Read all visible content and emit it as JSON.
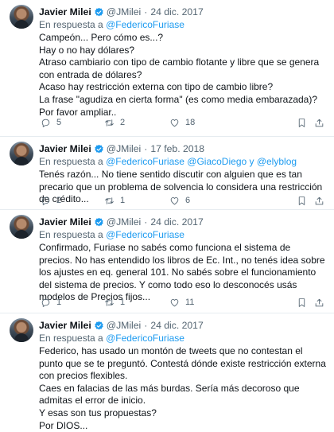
{
  "tweets": [
    {
      "author": "Javier Milei",
      "handle": "@JMilei",
      "date": "24 dic. 2017",
      "reply_prefix": "En respuesta a ",
      "reply_to": "@FedericoFuriase",
      "reply_extra": "",
      "text": "Campeón... Pero cómo es...?\nHay o no hay dólares?\nAtraso cambiario con tipo de cambio flotante y libre que se genera con entrada de dólares?\nAcaso hay restricción externa con tipo de cambio libre?\nLa frase \"agudiza en cierta forma\" (es como media embarazada)?\nPor favor ampliar..",
      "replies": "5",
      "retweets": "2",
      "likes": "18"
    },
    {
      "author": "Javier Milei",
      "handle": "@JMilei",
      "date": "17 feb. 2018",
      "reply_prefix": "En respuesta a ",
      "reply_to": "@FedericoFuriase @GiacoDiego y @elyblog",
      "reply_extra": "",
      "text": "Tenés razón... No tiene sentido discutir con alguien que es tan precario que un problema de solvencia lo considera una restricción de crédito...",
      "replies": "2",
      "retweets": "1",
      "likes": "6"
    },
    {
      "author": "Javier Milei",
      "handle": "@JMilei",
      "date": "24 dic. 2017",
      "reply_prefix": "En respuesta a ",
      "reply_to": "@FedericoFuriase",
      "reply_extra": "",
      "text": "Confirmado, Furiase no sabés como funciona el sistema de precios. No has entendido los libros de Ec. Int., no tenés idea sobre los ajustes en eq. general 101. No sabés sobre el funcionamiento del sistema de precios. Y como todo eso lo desconocés usás modelos de Precios fijos...",
      "replies": "1",
      "retweets": "1",
      "likes": "11"
    },
    {
      "author": "Javier Milei",
      "handle": "@JMilei",
      "date": "24 dic. 2017",
      "reply_prefix": "En respuesta a ",
      "reply_to": "@FedericoFuriase",
      "reply_extra": "",
      "text": "Federico, has usado un montón de tweets que no contestan el punto que se te preguntó. Contestá dónde existe restricción externa con precios flexibles.\nCaes en falacias de las más burdas. Sería más decoroso que admitas el error de inicio.\nY esas son tus propuestas?\nPor DIOS...",
      "replies": "",
      "retweets": "",
      "likes": ""
    }
  ],
  "icons": {
    "verified": "verified-badge-icon",
    "reply": "reply-icon",
    "retweet": "retweet-icon",
    "like": "heart-icon",
    "bookmark": "bookmark-icon",
    "share": "share-icon"
  },
  "colors": {
    "accent": "#1d9bf0",
    "secondary_text": "#536471",
    "text": "#0f1419"
  }
}
